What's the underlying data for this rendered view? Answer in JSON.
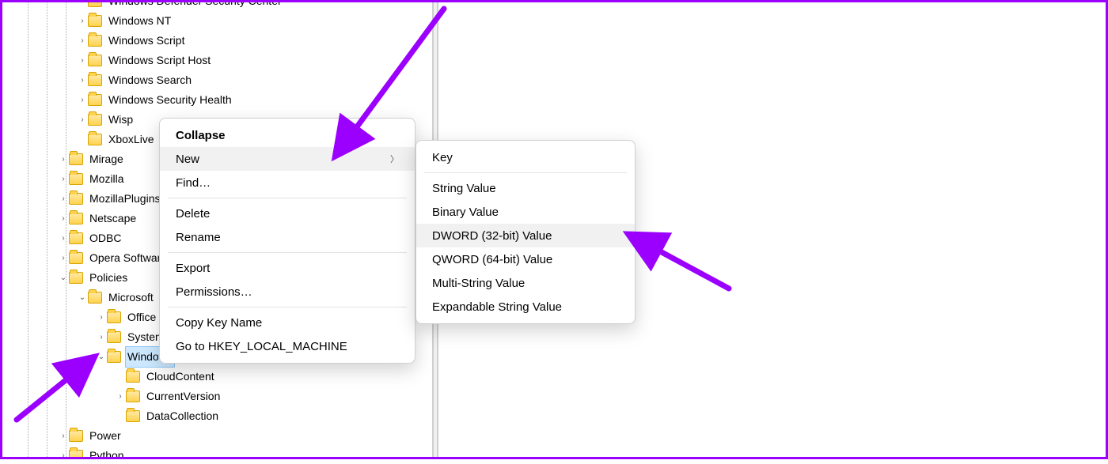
{
  "tree": {
    "lvl1": [
      {
        "label": "Windows Defender Security Center",
        "expand": "collapsed"
      },
      {
        "label": "Windows NT",
        "expand": "collapsed"
      },
      {
        "label": "Windows Script",
        "expand": "collapsed"
      },
      {
        "label": "Windows Script Host",
        "expand": "collapsed"
      },
      {
        "label": "Windows Search",
        "expand": "collapsed"
      },
      {
        "label": "Windows Security Health",
        "expand": "collapsed"
      },
      {
        "label": "Wisp",
        "expand": "collapsed"
      },
      {
        "label": "XboxLive",
        "expand": "none"
      }
    ],
    "lvl2": [
      {
        "label": "Mirage",
        "expand": "collapsed"
      },
      {
        "label": "Mozilla",
        "expand": "collapsed"
      },
      {
        "label": "MozillaPlugins",
        "expand": "collapsed"
      },
      {
        "label": "Netscape",
        "expand": "collapsed"
      },
      {
        "label": "ODBC",
        "expand": "collapsed"
      },
      {
        "label": "Opera Software",
        "expand": "collapsed"
      },
      {
        "label": "Policies",
        "expand": "expanded"
      }
    ],
    "policies_children": [
      {
        "label": "Microsoft",
        "expand": "expanded"
      }
    ],
    "microsoft_children": [
      {
        "label": "Office",
        "expand": "collapsed"
      },
      {
        "label": "SystemCertificates",
        "expand": "collapsed"
      },
      {
        "label": "Windows",
        "expand": "expanded",
        "selected": true
      }
    ],
    "windows_children": [
      {
        "label": "CloudContent",
        "expand": "none"
      },
      {
        "label": "CurrentVersion",
        "expand": "collapsed"
      },
      {
        "label": "DataCollection",
        "expand": "none"
      }
    ],
    "lvl2_after": [
      {
        "label": "Power",
        "expand": "collapsed"
      },
      {
        "label": "Python",
        "expand": "collapsed"
      }
    ]
  },
  "ctx1": {
    "collapse": "Collapse",
    "new": "New",
    "find": "Find…",
    "delete": "Delete",
    "rename": "Rename",
    "export": "Export",
    "permissions": "Permissions…",
    "copy_key": "Copy Key Name",
    "go_to": "Go to HKEY_LOCAL_MACHINE"
  },
  "ctx2": {
    "key": "Key",
    "string": "String Value",
    "binary": "Binary Value",
    "dword": "DWORD (32-bit) Value",
    "qword": "QWORD (64-bit) Value",
    "multi": "Multi-String Value",
    "expand": "Expandable String Value"
  }
}
